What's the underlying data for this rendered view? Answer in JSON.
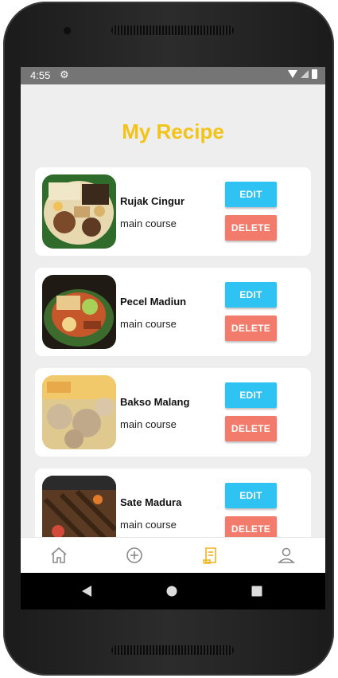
{
  "status": {
    "time": "4:55"
  },
  "header": {
    "title": "My Recipe"
  },
  "recipes": [
    {
      "name": "Rujak Cingur",
      "category": "main course",
      "edit_label": "EDIT",
      "delete_label": "DELETE"
    },
    {
      "name": "Pecel Madiun",
      "category": "main course",
      "edit_label": "EDIT",
      "delete_label": "DELETE"
    },
    {
      "name": "Bakso Malang",
      "category": "main course",
      "edit_label": "EDIT",
      "delete_label": "DELETE"
    },
    {
      "name": "Sate Madura",
      "category": "main course",
      "edit_label": "EDIT",
      "delete_label": "DELETE"
    }
  ],
  "bottom_nav": {
    "items": [
      {
        "icon": "home-icon",
        "active": false
      },
      {
        "icon": "add-circle-icon",
        "active": false
      },
      {
        "icon": "recipe-icon",
        "active": true
      },
      {
        "icon": "profile-icon",
        "active": false
      }
    ]
  },
  "colors": {
    "title": "#f2c318",
    "edit": "#2ec3f2",
    "delete": "#f27b6b",
    "active_nav": "#f2b31a"
  }
}
